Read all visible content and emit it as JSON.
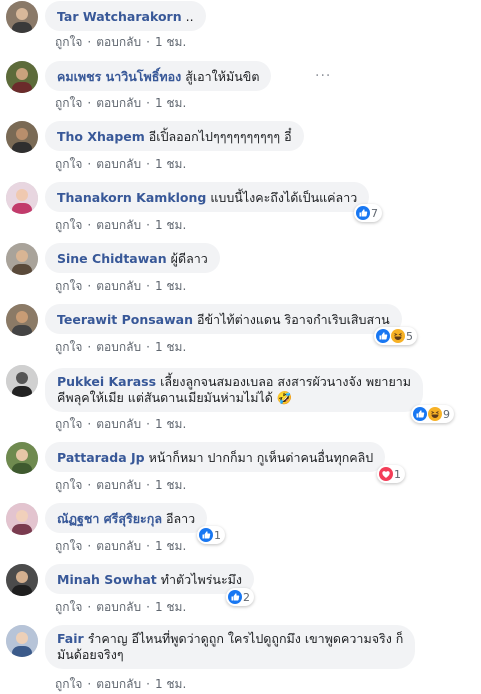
{
  "actions": {
    "like": "ถูกใจ",
    "reply": "ตอบกลับ",
    "time": "1 ชม.",
    "sep": "·"
  },
  "comments": [
    {
      "name": "Tar Watcharakorn",
      "text": ".."
    },
    {
      "name": "คมเพชร นาวินโพธิ์ทอง",
      "text": "สู้เอาให้มันขิต"
    },
    {
      "name": "Tho Xhapem",
      "text": "อีเปิ้ลออกไปๆๆๆๆๆๆๆๆๆๆ อี๋"
    },
    {
      "name": "Thanakorn Kamklong",
      "text": "แบบนี้ไงคะถึงได้เป็นแค่ลาว",
      "reaction_count": "7"
    },
    {
      "name": "Sine Chidtawan",
      "text": "ผู้ดีลาว"
    },
    {
      "name": "Teerawit Ponsawan",
      "text": "อีข้าไท้ต่างแดน ริอาจกำเริบเสิบสาน",
      "reaction_count": "5"
    },
    {
      "name": "Pukkei Karass",
      "text_line1": "เลี้ยงลูกจนสมองเบลอ สงสารผัวนางจัง พยายาม",
      "text_line2": "คีพลุคให้เมีย แต่สันดานเมียมันห่ามไม่ได้ 🤣",
      "reaction_count": "9"
    },
    {
      "name": "Pattarada Jp",
      "text": "หน้าก็หมา ปากก็มา กูเห็นด่าคนอื่นทุกคลิป",
      "reaction_count": "1"
    },
    {
      "name": "ณัฏฐชา ศรีสุริยะกุล",
      "text": "อีลาว",
      "reaction_count": "1"
    },
    {
      "name": "Minah Sowhat",
      "text": "ทำตัวไพร่นะมึง",
      "reaction_count": "2"
    },
    {
      "name": "Fair",
      "text_line1": "รำคาญ อีไหนที่พูดว่าดูถูก ใครไปดูถูกมึง เขาพูดความจริง ก็",
      "text_line2": "มันด้อยจริงๆ"
    }
  ],
  "colors": {
    "name": "#385898",
    "bubble": "#f2f3f5",
    "meta": "#606770",
    "like": "#1877f2",
    "heart": "#f33e58",
    "haha": "#f7b125"
  },
  "icons": {
    "like": "thumbs-up-icon",
    "haha": "haha-emoji-icon",
    "heart": "heart-icon",
    "more": "more-options-icon"
  }
}
